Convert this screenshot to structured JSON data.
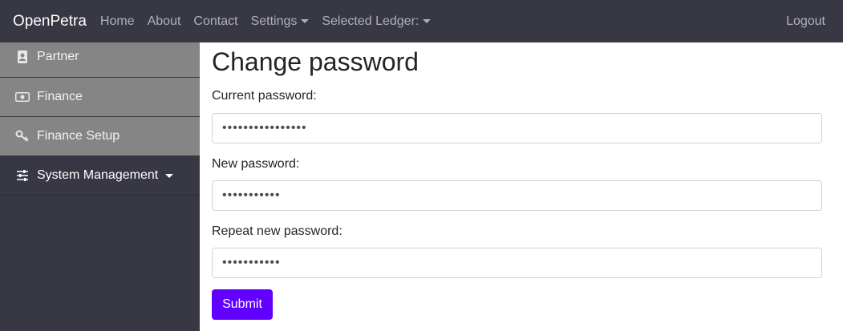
{
  "navbar": {
    "brand": "OpenPetra",
    "links": {
      "home": "Home",
      "about": "About",
      "contact": "Contact",
      "settings": "Settings",
      "selected_ledger": "Selected Ledger:"
    },
    "logout": "Logout"
  },
  "sidebar": {
    "items": [
      {
        "label": "Partner",
        "icon": "contact-card-icon"
      },
      {
        "label": "Finance",
        "icon": "money-bill-icon"
      },
      {
        "label": "Finance Setup",
        "icon": "key-icon"
      },
      {
        "label": "System Management",
        "icon": "sliders-icon"
      }
    ]
  },
  "form": {
    "title": "Change password",
    "current_label": "Current password:",
    "current_value": "0123456789abcdef",
    "new_label": "New password:",
    "new_value": "0123456789a",
    "repeat_label": "Repeat new password:",
    "repeat_value": "0123456789a",
    "submit": "Submit"
  },
  "colors": {
    "navbar_bg": "#383844",
    "sidebar_item_bg": "#858585",
    "submit_bg": "#6200ff"
  }
}
